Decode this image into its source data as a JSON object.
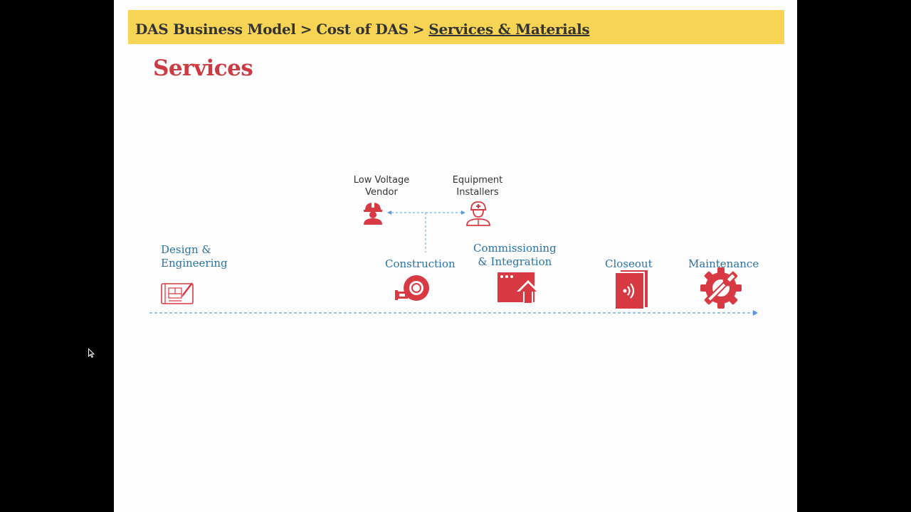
{
  "breadcrumb": {
    "level1": "DAS Business Model",
    "separator": ">",
    "level2": "Cost of DAS",
    "current": "Services & Materials"
  },
  "page_title": "Services",
  "roles": {
    "low_voltage": {
      "line1": "Low Voltage",
      "line2": "Vendor",
      "icon": "hardhat-worker-icon"
    },
    "equipment": {
      "line1": "Equipment",
      "line2": "Installers",
      "icon": "nurse-worker-icon"
    }
  },
  "stages": [
    {
      "line1": "Design &",
      "line2": "Engineering",
      "icon": "blueprint-icon"
    },
    {
      "line1": "Construction",
      "icon": "tape-measure-icon"
    },
    {
      "line1": "Commissioning",
      "line2": "& Integration",
      "icon": "browser-upload-icon"
    },
    {
      "line1": "Closeout",
      "icon": "document-signal-icon"
    },
    {
      "line1": "Maintenance",
      "icon": "gear-wrench-icon"
    }
  ],
  "colors": {
    "banner": "#f7d454",
    "title": "#cc3b43",
    "stage_text": "#2872a5",
    "icon": "#d83a44",
    "timeline": "#5b9bd5"
  }
}
